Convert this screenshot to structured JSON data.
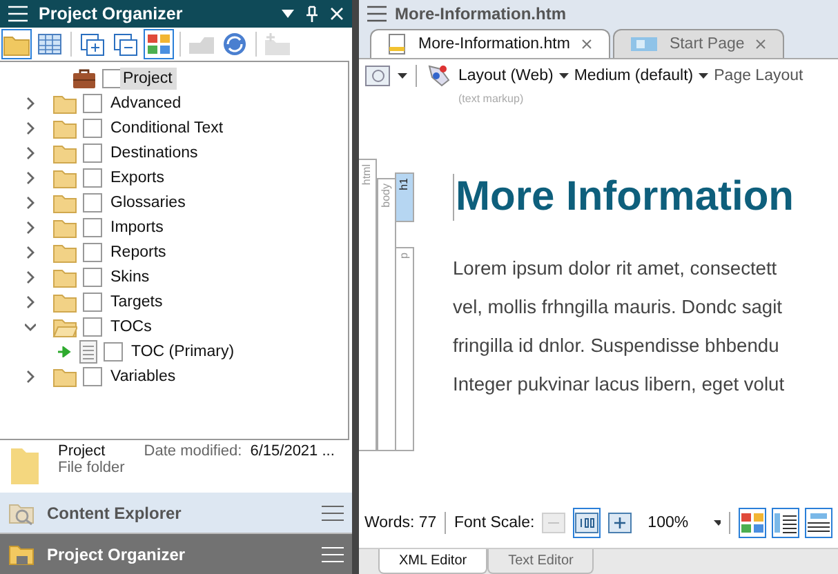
{
  "left_panel": {
    "title": "Project Organizer",
    "toolbar": [
      {
        "kind": "folder",
        "selected": true,
        "disabled": false
      },
      {
        "kind": "grid",
        "selected": false,
        "disabled": false
      },
      {
        "kind": "sep"
      },
      {
        "kind": "expand",
        "selected": false,
        "disabled": false
      },
      {
        "kind": "collapse",
        "selected": false,
        "disabled": false
      },
      {
        "kind": "tiles",
        "selected": true,
        "disabled": false
      },
      {
        "kind": "sep"
      },
      {
        "kind": "upload",
        "selected": false,
        "disabled": true
      },
      {
        "kind": "sync",
        "selected": false,
        "disabled": false
      },
      {
        "kind": "sep"
      },
      {
        "kind": "newfolder",
        "selected": false,
        "disabled": true
      }
    ],
    "tree": {
      "label": "Project",
      "kind": "project",
      "selected": true,
      "checked": false,
      "children": [
        {
          "label": "Advanced",
          "kind": "folder",
          "expanded": false,
          "checked": false
        },
        {
          "label": "Conditional Text",
          "kind": "folder",
          "expanded": false,
          "checked": false
        },
        {
          "label": "Destinations",
          "kind": "folder",
          "expanded": false,
          "checked": false
        },
        {
          "label": "Exports",
          "kind": "folder",
          "expanded": false,
          "checked": false
        },
        {
          "label": "Glossaries",
          "kind": "folder",
          "expanded": false,
          "checked": false
        },
        {
          "label": "Imports",
          "kind": "folder",
          "expanded": false,
          "checked": false
        },
        {
          "label": "Reports",
          "kind": "folder",
          "expanded": false,
          "checked": false
        },
        {
          "label": "Skins",
          "kind": "folder",
          "expanded": false,
          "checked": false
        },
        {
          "label": "Targets",
          "kind": "folder",
          "expanded": false,
          "checked": false
        },
        {
          "label": "TOCs",
          "kind": "folder",
          "expanded": true,
          "checked": false,
          "children": [
            {
              "label": "TOC (Primary)",
              "kind": "toc",
              "primary": true,
              "checked": false
            }
          ]
        },
        {
          "label": "Variables",
          "kind": "folder",
          "expanded": false,
          "checked": false
        }
      ]
    },
    "details": {
      "name": "Project",
      "type": "File folder",
      "date_label": "Date modified:",
      "date_value": "6/15/2021 ..."
    },
    "nav": [
      {
        "label": "Content Explorer",
        "kind": "explorer",
        "selected": false
      },
      {
        "label": "Project Organizer",
        "kind": "organizer",
        "selected": true
      }
    ]
  },
  "editor": {
    "title": "More-Information.htm",
    "tabs": [
      {
        "label": "More-Information.htm",
        "kind": "doc",
        "selected": true
      },
      {
        "label": "Start Page",
        "kind": "start",
        "selected": false
      }
    ],
    "toolbar": {
      "dropdowns": [
        "Layout (Web)",
        "Medium (default)",
        "Page Layout"
      ],
      "hint": "(text markup)"
    },
    "structure_bars": [
      {
        "label": "html",
        "selected": false
      },
      {
        "label": "body",
        "selected": false
      },
      {
        "label": "h1",
        "selected": true
      },
      {
        "label": "p",
        "selected": false
      }
    ],
    "heading": "More Information",
    "paragraph_lines": [
      "Lorem ipsum dolor rit amet, consectett",
      "vel, mollis frhngilla mauris. Dondc sagit",
      "fringilla id dnlor. Suspendisse bhbendu",
      "Integer pukvinar lacus libern, eget volut"
    ],
    "status": {
      "words": "Words: 77",
      "font_scale": "Font Scale:",
      "zoom": "100%",
      "buttons": [
        {
          "kind": "minus",
          "selected": false,
          "disabled": true
        },
        {
          "kind": "reset",
          "selected": true,
          "disabled": false
        },
        {
          "kind": "plus",
          "selected": false,
          "disabled": false
        }
      ],
      "view_buttons": [
        {
          "kind": "tiles",
          "selected": true
        },
        {
          "kind": "left",
          "selected": true
        },
        {
          "kind": "top",
          "selected": true
        }
      ]
    },
    "bottom_tabs": [
      {
        "label": "XML Editor",
        "selected": true
      },
      {
        "label": "Text Editor",
        "selected": false
      }
    ]
  }
}
